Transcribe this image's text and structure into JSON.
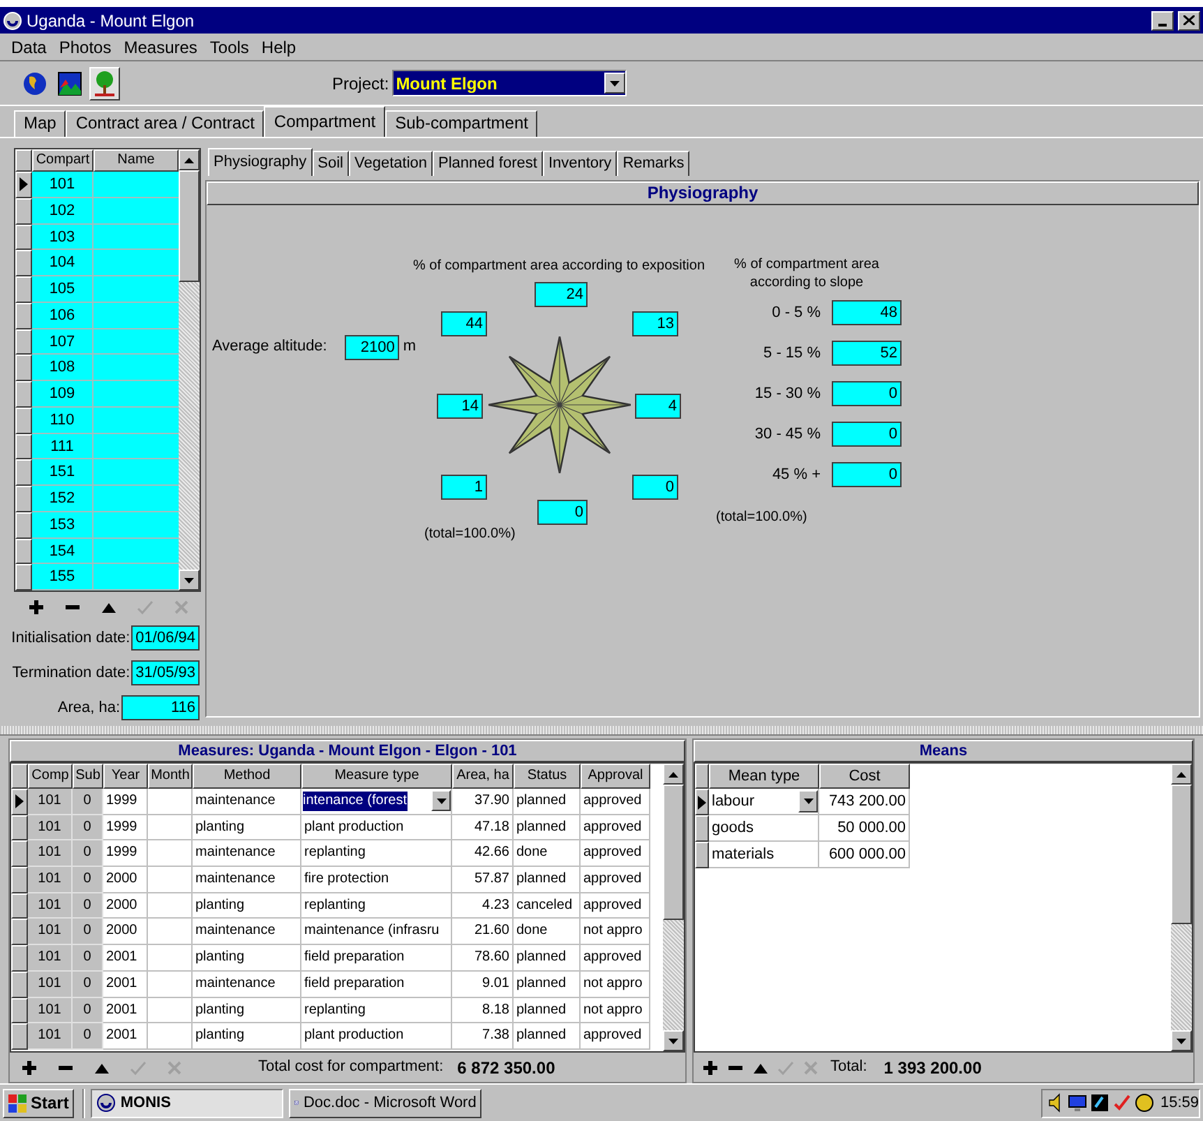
{
  "window": {
    "title": "Uganda - Mount Elgon"
  },
  "menu": [
    "Data",
    "Photos",
    "Measures",
    "Tools",
    "Help"
  ],
  "toolbar": [
    {
      "kind": "globe",
      "selected": false
    },
    {
      "kind": "landscape",
      "selected": false
    },
    {
      "kind": "tree",
      "selected": true
    }
  ],
  "project": {
    "label": "Project:",
    "value": "Mount Elgon"
  },
  "main_tabs": [
    {
      "label": "Map",
      "selected": false
    },
    {
      "label": "Contract area / Contract",
      "selected": false
    },
    {
      "label": "Compartment",
      "selected": true
    },
    {
      "label": "Sub-compartment",
      "selected": false
    }
  ],
  "compartments": {
    "columns": [
      "Compart",
      "Name"
    ],
    "rows": [
      {
        "compart": "101",
        "selected": true
      },
      {
        "compart": "102",
        "selected": false
      },
      {
        "compart": "103",
        "selected": false
      },
      {
        "compart": "104",
        "selected": false
      },
      {
        "compart": "105",
        "selected": false
      },
      {
        "compart": "106",
        "selected": false
      },
      {
        "compart": "107",
        "selected": false
      },
      {
        "compart": "108",
        "selected": false
      },
      {
        "compart": "109",
        "selected": false
      },
      {
        "compart": "110",
        "selected": false
      },
      {
        "compart": "111",
        "selected": false
      },
      {
        "compart": "151",
        "selected": false
      },
      {
        "compart": "152",
        "selected": false
      },
      {
        "compart": "153",
        "selected": false
      },
      {
        "compart": "154",
        "selected": false
      },
      {
        "compart": "155",
        "selected": false
      }
    ]
  },
  "record_buttons": [
    {
      "kind": "add",
      "disabled": false
    },
    {
      "kind": "remove",
      "disabled": false
    },
    {
      "kind": "up",
      "disabled": false
    },
    {
      "kind": "confirm",
      "disabled": true
    },
    {
      "kind": "cancel",
      "disabled": true
    }
  ],
  "compartment_fields": [
    {
      "label": "Initialisation date:",
      "value": "01/06/94"
    },
    {
      "label": "Termination date:",
      "value": "31/05/93"
    },
    {
      "label": "Area, ha:",
      "value": "116"
    }
  ],
  "sub_tabs": [
    {
      "label": "Physiography",
      "selected": true
    },
    {
      "label": "Soil",
      "selected": false
    },
    {
      "label": "Vegetation",
      "selected": false
    },
    {
      "label": "Planned forest",
      "selected": false
    },
    {
      "label": "Inventory",
      "selected": false
    },
    {
      "label": "Remarks",
      "selected": false
    }
  ],
  "physiography": {
    "title": "Physiography",
    "altitude": {
      "label": "Average altitude:",
      "value": "2100",
      "unit": "m"
    },
    "exposition": {
      "title": "% of compartment area according to exposition",
      "values": [
        "24",
        "44",
        "13",
        "14",
        "4",
        "1",
        "0",
        "0"
      ],
      "total": "(total=100.0%)"
    },
    "slope": {
      "title": "% of compartment area according to slope",
      "rows": [
        {
          "label": "0 - 5 %",
          "value": "48"
        },
        {
          "label": "5 - 15 %",
          "value": "52"
        },
        {
          "label": "15 - 30 %",
          "value": "0"
        },
        {
          "label": "30 - 45 %",
          "value": "0"
        },
        {
          "label": "45 % +",
          "value": "0"
        }
      ],
      "total": "(total=100.0%)"
    }
  },
  "measures": {
    "title": "Measures: Uganda - Mount Elgon - Elgon - 101",
    "columns": [
      {
        "label": "Comp",
        "shaded": true
      },
      {
        "label": "Sub",
        "shaded": true
      },
      {
        "label": "Year",
        "shaded": false
      },
      {
        "label": "Month",
        "shaded": false
      },
      {
        "label": "Method",
        "shaded": false
      },
      {
        "label": "Measure type",
        "shaded": false
      },
      {
        "label": "Area, ha",
        "shaded": false
      },
      {
        "label": "Status",
        "shaded": false
      },
      {
        "label": "Approval",
        "shaded": false
      }
    ],
    "rows": [
      {
        "comp": "101",
        "sub": "0",
        "year": "1999",
        "method": "maintenance",
        "measure_type": "intenance (forest",
        "area": "37.90",
        "status": "planned",
        "approval": "approved",
        "selected": true,
        "editing": true
      },
      {
        "comp": "101",
        "sub": "0",
        "year": "1999",
        "method": "planting",
        "measure_type": "plant production",
        "area": "47.18",
        "status": "planned",
        "approval": "approved",
        "selected": false,
        "editing": false
      },
      {
        "comp": "101",
        "sub": "0",
        "year": "1999",
        "method": "maintenance",
        "measure_type": "replanting",
        "area": "42.66",
        "status": "done",
        "approval": "approved",
        "selected": false,
        "editing": false
      },
      {
        "comp": "101",
        "sub": "0",
        "year": "2000",
        "method": "maintenance",
        "measure_type": "fire protection",
        "area": "57.87",
        "status": "planned",
        "approval": "approved",
        "selected": false,
        "editing": false
      },
      {
        "comp": "101",
        "sub": "0",
        "year": "2000",
        "method": "planting",
        "measure_type": "replanting",
        "area": "4.23",
        "status": "canceled",
        "approval": "approved",
        "selected": false,
        "editing": false
      },
      {
        "comp": "101",
        "sub": "0",
        "year": "2000",
        "method": "maintenance",
        "measure_type": "maintenance (infrasru",
        "area": "21.60",
        "status": "done",
        "approval": "not appro",
        "selected": false,
        "editing": false
      },
      {
        "comp": "101",
        "sub": "0",
        "year": "2001",
        "method": "planting",
        "measure_type": "field preparation",
        "area": "78.60",
        "status": "planned",
        "approval": "approved",
        "selected": false,
        "editing": false
      },
      {
        "comp": "101",
        "sub": "0",
        "year": "2001",
        "method": "maintenance",
        "measure_type": "field preparation",
        "area": "9.01",
        "status": "planned",
        "approval": "not appro",
        "selected": false,
        "editing": false
      },
      {
        "comp": "101",
        "sub": "0",
        "year": "2001",
        "method": "planting",
        "measure_type": "replanting",
        "area": "8.18",
        "status": "planned",
        "approval": "not appro",
        "selected": false,
        "editing": false
      },
      {
        "comp": "101",
        "sub": "0",
        "year": "2001",
        "method": "planting",
        "measure_type": "plant production",
        "area": "7.38",
        "status": "planned",
        "approval": "approved",
        "selected": false,
        "editing": false
      }
    ],
    "total_label": "Total cost for compartment:",
    "total": "6 872 350.00"
  },
  "means": {
    "title": "Means",
    "columns": [
      "Mean type",
      "Cost"
    ],
    "rows": [
      {
        "mean_type": "labour",
        "cost": "743 200.00",
        "selected": true,
        "editing": true
      },
      {
        "mean_type": "goods",
        "cost": "50 000.00",
        "selected": false,
        "editing": false
      },
      {
        "mean_type": "materials",
        "cost": "600 000.00",
        "selected": false,
        "editing": false
      }
    ],
    "total_label": "Total:",
    "total": "1 393 200.00"
  },
  "taskbar": {
    "start": "Start",
    "tasks": [
      {
        "label": "MONIS",
        "kind": "app",
        "selected": true
      },
      {
        "label": "Doc.doc - Microsoft Word",
        "kind": "word",
        "selected": false
      }
    ],
    "clock": "15:59"
  }
}
